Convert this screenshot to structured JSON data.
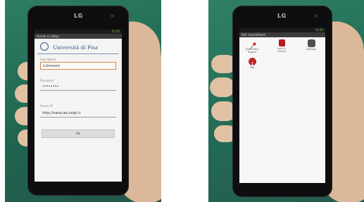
{
  "left_phone": {
    "brand": "LG",
    "status": "12:25",
    "title": "Accedi a LabSys",
    "university": "Università di Pisa",
    "username_label": "User Name",
    "username_value": "e.bravaro",
    "password_label": "Password",
    "password_value": "••••••••",
    "server_label": "Server IP",
    "server_value": "http://nano.iet.unipi.it",
    "ok_label": "Ok"
  },
  "right_phone": {
    "brand": "LG",
    "status": "12:25",
    "title": "BLE ControlPanel",
    "apps": [
      {
        "label": "Bacchetta Magica",
        "icon": "wand-icon",
        "color": "#c62828"
      },
      {
        "label": "Lock & Unlock",
        "icon": "lock-icon",
        "color": "#b71c1c"
      },
      {
        "label": "Settings",
        "icon": "settings-icon",
        "color": "#4e4e4e"
      },
      {
        "label": "Info",
        "icon": "info-icon",
        "color": "#c62828"
      }
    ]
  }
}
